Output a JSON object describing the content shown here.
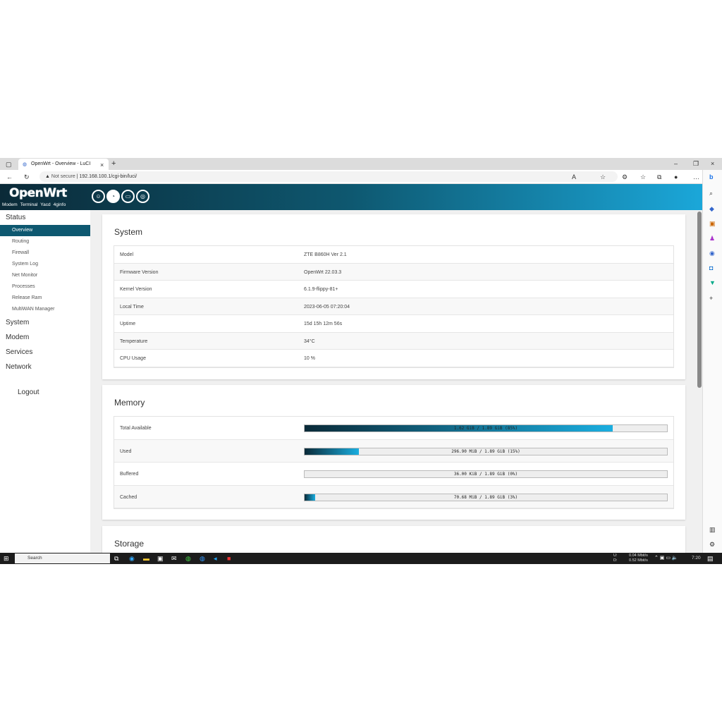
{
  "browser": {
    "tab_title": "OpenWrt - Overview - LuCI",
    "security": "Not secure",
    "url": "192.168.100.1/cgi-bin/luci/"
  },
  "header": {
    "logo": "OpenWrt",
    "links": [
      "Modem",
      "Terminal",
      "Yacd",
      "4ginfo"
    ]
  },
  "sidebar": {
    "status": "Status",
    "sub": [
      "Overview",
      "Routing",
      "Firewall",
      "System Log",
      "Net Monitor",
      "Processes",
      "Release Ram",
      "MultiWAN Manager"
    ],
    "sections": [
      "System",
      "Modem",
      "Services",
      "Network"
    ],
    "logout": "Logout"
  },
  "system": {
    "title": "System",
    "rows": [
      {
        "k": "Model",
        "v": "ZTE B860H Ver 2.1"
      },
      {
        "k": "Firmware Version",
        "v": "OpenWrt 22.03.3"
      },
      {
        "k": "Kernel Version",
        "v": "6.1.9-flippy-81+"
      },
      {
        "k": "Local Time",
        "v": "2023-06-05 07:20:04"
      },
      {
        "k": "Uptime",
        "v": "15d 15h 12m 56s"
      },
      {
        "k": "Temperature",
        "v": "34°C"
      },
      {
        "k": "CPU Usage",
        "v": "10 %"
      }
    ]
  },
  "memory": {
    "title": "Memory",
    "rows": [
      {
        "k": "Total Available",
        "v": "1.62 GiB / 1.89 GiB (85%)",
        "pct": 85
      },
      {
        "k": "Used",
        "v": "296.90 MiB / 1.89 GiB (15%)",
        "pct": 15
      },
      {
        "k": "Buffered",
        "v": "36.00 KiB / 1.89 GiB (0%)",
        "pct": 0
      },
      {
        "k": "Cached",
        "v": "70.68 MiB / 1.89 GiB (3%)",
        "pct": 3
      }
    ]
  },
  "storage": {
    "title": "Storage"
  },
  "taskbar": {
    "search": "Search",
    "up_label": "U:",
    "down_label": "D:",
    "up": "0.04 Mbit/s",
    "down": "0.52 Mbit/s",
    "time": "7:20"
  }
}
